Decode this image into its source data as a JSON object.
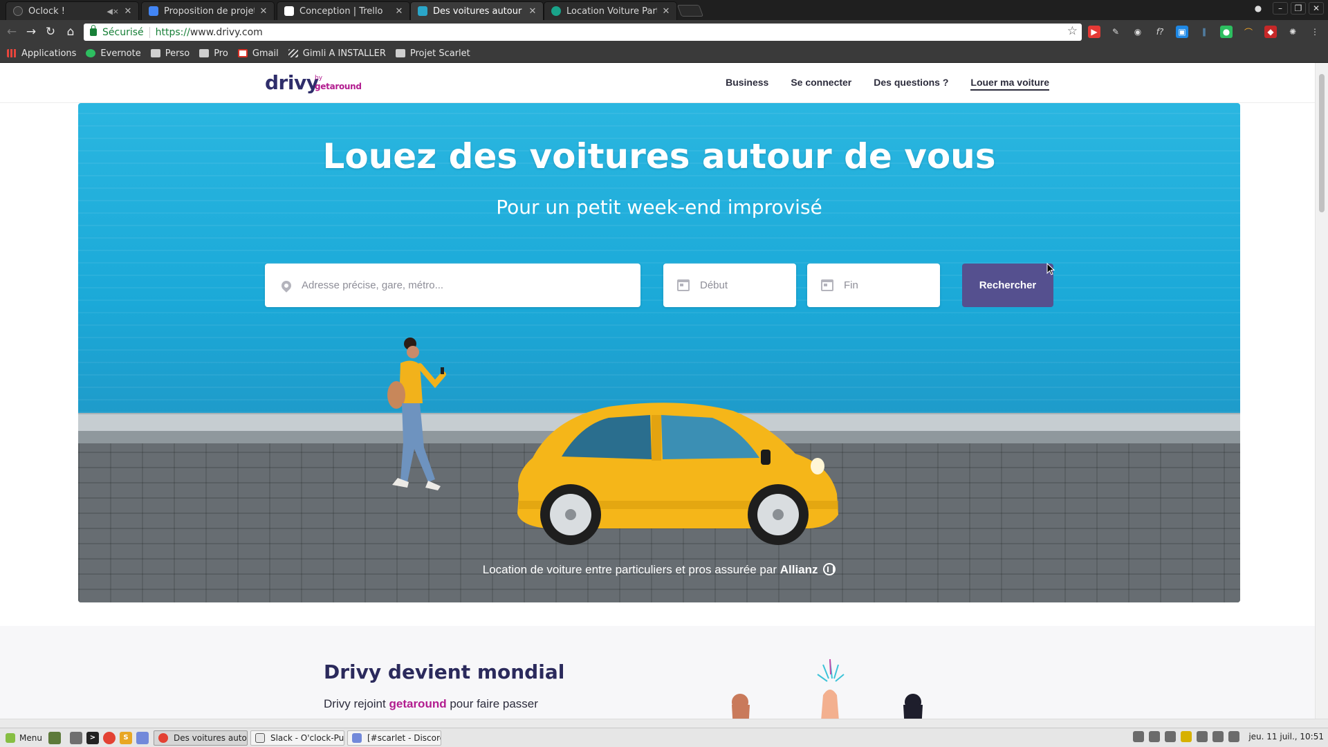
{
  "browser": {
    "tabs": [
      {
        "label": "Oclock !",
        "favicon_color": "#3a3a3a",
        "muted": true,
        "active": false
      },
      {
        "label": "Proposition de projet - G",
        "favicon_color": "#4285f4",
        "muted": false,
        "active": false
      },
      {
        "label": "Conception | Trello",
        "favicon_color": "#ffffff",
        "muted": false,
        "active": false
      },
      {
        "label": "Des voitures autour de",
        "favicon_color": "#2aa6c9",
        "muted": false,
        "active": true
      },
      {
        "label": "Location Voiture Particu",
        "favicon_color": "#19a38a",
        "muted": false,
        "active": false
      }
    ],
    "secure_label": "Sécurisé",
    "url_scheme": "https://",
    "url_host": "www.drivy.com",
    "bookmarks": [
      {
        "label": "Applications",
        "icon": "apps-grid-icon",
        "color": "#e8453c"
      },
      {
        "label": "Evernote",
        "icon": "evernote-icon",
        "color": "#2dbe60"
      },
      {
        "label": "Perso",
        "icon": "folder-icon",
        "color": "#cfcfcf"
      },
      {
        "label": "Pro",
        "icon": "folder-icon",
        "color": "#cfcfcf"
      },
      {
        "label": "Gmail",
        "icon": "gmail-icon",
        "color": "#d93025"
      },
      {
        "label": "Gimli A INSTALLER",
        "icon": "link-icon",
        "color": "#dddddd"
      },
      {
        "label": "Projet Scarlet",
        "icon": "folder-icon",
        "color": "#cfcfcf"
      }
    ]
  },
  "site": {
    "logo": "drivy",
    "logo_by": "by",
    "logo_partner": "getaround",
    "nav": [
      "Business",
      "Se connecter",
      "Des questions ?",
      "Louer ma voiture"
    ],
    "hero": {
      "title": "Louez des voitures autour de vous",
      "subtitle": "Pour un petit week-end improvisé",
      "address_placeholder": "Adresse précise, gare, métro...",
      "start_placeholder": "Début",
      "end_placeholder": "Fin",
      "search_label": "Rechercher",
      "insurance_text": "Location de voiture entre particuliers et pros assurée par",
      "insurer": "Allianz"
    },
    "section": {
      "title": "Drivy devient mondial",
      "text_before": "Drivy rejoint",
      "text_brand": "getaround",
      "text_after": "pour faire passer"
    }
  },
  "taskbar": {
    "menu_label": "Menu",
    "windows": [
      {
        "label": "Des voitures autour ...",
        "active": true,
        "color": "#2aa6c9"
      },
      {
        "label": "Slack - O'clock-Pulsar",
        "active": false,
        "color": "#4a4a4a"
      },
      {
        "label": "[#scarlet - Discord]",
        "active": false,
        "color": "#7289da"
      }
    ],
    "clock": "jeu. 11 juil., 10:51"
  },
  "colors": {
    "brand": "#2f2e6b",
    "partner": "#b21c8f",
    "button": "#55508f",
    "hero_sky": "#1ba9d8"
  }
}
